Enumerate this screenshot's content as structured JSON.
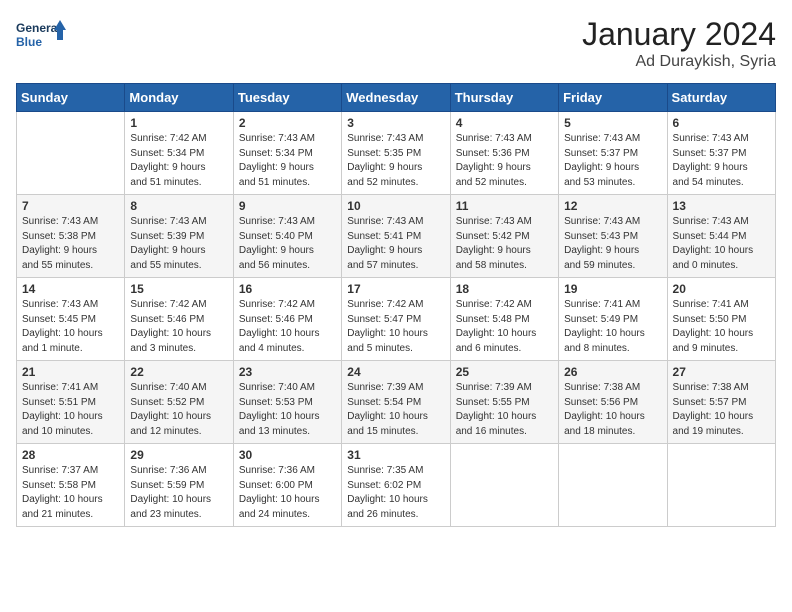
{
  "logo": {
    "line1": "General",
    "line2": "Blue"
  },
  "title": "January 2024",
  "location": "Ad Duraykish, Syria",
  "days_header": [
    "Sunday",
    "Monday",
    "Tuesday",
    "Wednesday",
    "Thursday",
    "Friday",
    "Saturday"
  ],
  "weeks": [
    [
      {
        "day": "",
        "info": ""
      },
      {
        "day": "1",
        "info": "Sunrise: 7:42 AM\nSunset: 5:34 PM\nDaylight: 9 hours\nand 51 minutes."
      },
      {
        "day": "2",
        "info": "Sunrise: 7:43 AM\nSunset: 5:34 PM\nDaylight: 9 hours\nand 51 minutes."
      },
      {
        "day": "3",
        "info": "Sunrise: 7:43 AM\nSunset: 5:35 PM\nDaylight: 9 hours\nand 52 minutes."
      },
      {
        "day": "4",
        "info": "Sunrise: 7:43 AM\nSunset: 5:36 PM\nDaylight: 9 hours\nand 52 minutes."
      },
      {
        "day": "5",
        "info": "Sunrise: 7:43 AM\nSunset: 5:37 PM\nDaylight: 9 hours\nand 53 minutes."
      },
      {
        "day": "6",
        "info": "Sunrise: 7:43 AM\nSunset: 5:37 PM\nDaylight: 9 hours\nand 54 minutes."
      }
    ],
    [
      {
        "day": "7",
        "info": "Sunrise: 7:43 AM\nSunset: 5:38 PM\nDaylight: 9 hours\nand 55 minutes."
      },
      {
        "day": "8",
        "info": "Sunrise: 7:43 AM\nSunset: 5:39 PM\nDaylight: 9 hours\nand 55 minutes."
      },
      {
        "day": "9",
        "info": "Sunrise: 7:43 AM\nSunset: 5:40 PM\nDaylight: 9 hours\nand 56 minutes."
      },
      {
        "day": "10",
        "info": "Sunrise: 7:43 AM\nSunset: 5:41 PM\nDaylight: 9 hours\nand 57 minutes."
      },
      {
        "day": "11",
        "info": "Sunrise: 7:43 AM\nSunset: 5:42 PM\nDaylight: 9 hours\nand 58 minutes."
      },
      {
        "day": "12",
        "info": "Sunrise: 7:43 AM\nSunset: 5:43 PM\nDaylight: 9 hours\nand 59 minutes."
      },
      {
        "day": "13",
        "info": "Sunrise: 7:43 AM\nSunset: 5:44 PM\nDaylight: 10 hours\nand 0 minutes."
      }
    ],
    [
      {
        "day": "14",
        "info": "Sunrise: 7:43 AM\nSunset: 5:45 PM\nDaylight: 10 hours\nand 1 minute."
      },
      {
        "day": "15",
        "info": "Sunrise: 7:42 AM\nSunset: 5:46 PM\nDaylight: 10 hours\nand 3 minutes."
      },
      {
        "day": "16",
        "info": "Sunrise: 7:42 AM\nSunset: 5:46 PM\nDaylight: 10 hours\nand 4 minutes."
      },
      {
        "day": "17",
        "info": "Sunrise: 7:42 AM\nSunset: 5:47 PM\nDaylight: 10 hours\nand 5 minutes."
      },
      {
        "day": "18",
        "info": "Sunrise: 7:42 AM\nSunset: 5:48 PM\nDaylight: 10 hours\nand 6 minutes."
      },
      {
        "day": "19",
        "info": "Sunrise: 7:41 AM\nSunset: 5:49 PM\nDaylight: 10 hours\nand 8 minutes."
      },
      {
        "day": "20",
        "info": "Sunrise: 7:41 AM\nSunset: 5:50 PM\nDaylight: 10 hours\nand 9 minutes."
      }
    ],
    [
      {
        "day": "21",
        "info": "Sunrise: 7:41 AM\nSunset: 5:51 PM\nDaylight: 10 hours\nand 10 minutes."
      },
      {
        "day": "22",
        "info": "Sunrise: 7:40 AM\nSunset: 5:52 PM\nDaylight: 10 hours\nand 12 minutes."
      },
      {
        "day": "23",
        "info": "Sunrise: 7:40 AM\nSunset: 5:53 PM\nDaylight: 10 hours\nand 13 minutes."
      },
      {
        "day": "24",
        "info": "Sunrise: 7:39 AM\nSunset: 5:54 PM\nDaylight: 10 hours\nand 15 minutes."
      },
      {
        "day": "25",
        "info": "Sunrise: 7:39 AM\nSunset: 5:55 PM\nDaylight: 10 hours\nand 16 minutes."
      },
      {
        "day": "26",
        "info": "Sunrise: 7:38 AM\nSunset: 5:56 PM\nDaylight: 10 hours\nand 18 minutes."
      },
      {
        "day": "27",
        "info": "Sunrise: 7:38 AM\nSunset: 5:57 PM\nDaylight: 10 hours\nand 19 minutes."
      }
    ],
    [
      {
        "day": "28",
        "info": "Sunrise: 7:37 AM\nSunset: 5:58 PM\nDaylight: 10 hours\nand 21 minutes."
      },
      {
        "day": "29",
        "info": "Sunrise: 7:36 AM\nSunset: 5:59 PM\nDaylight: 10 hours\nand 23 minutes."
      },
      {
        "day": "30",
        "info": "Sunrise: 7:36 AM\nSunset: 6:00 PM\nDaylight: 10 hours\nand 24 minutes."
      },
      {
        "day": "31",
        "info": "Sunrise: 7:35 AM\nSunset: 6:02 PM\nDaylight: 10 hours\nand 26 minutes."
      },
      {
        "day": "",
        "info": ""
      },
      {
        "day": "",
        "info": ""
      },
      {
        "day": "",
        "info": ""
      }
    ]
  ]
}
